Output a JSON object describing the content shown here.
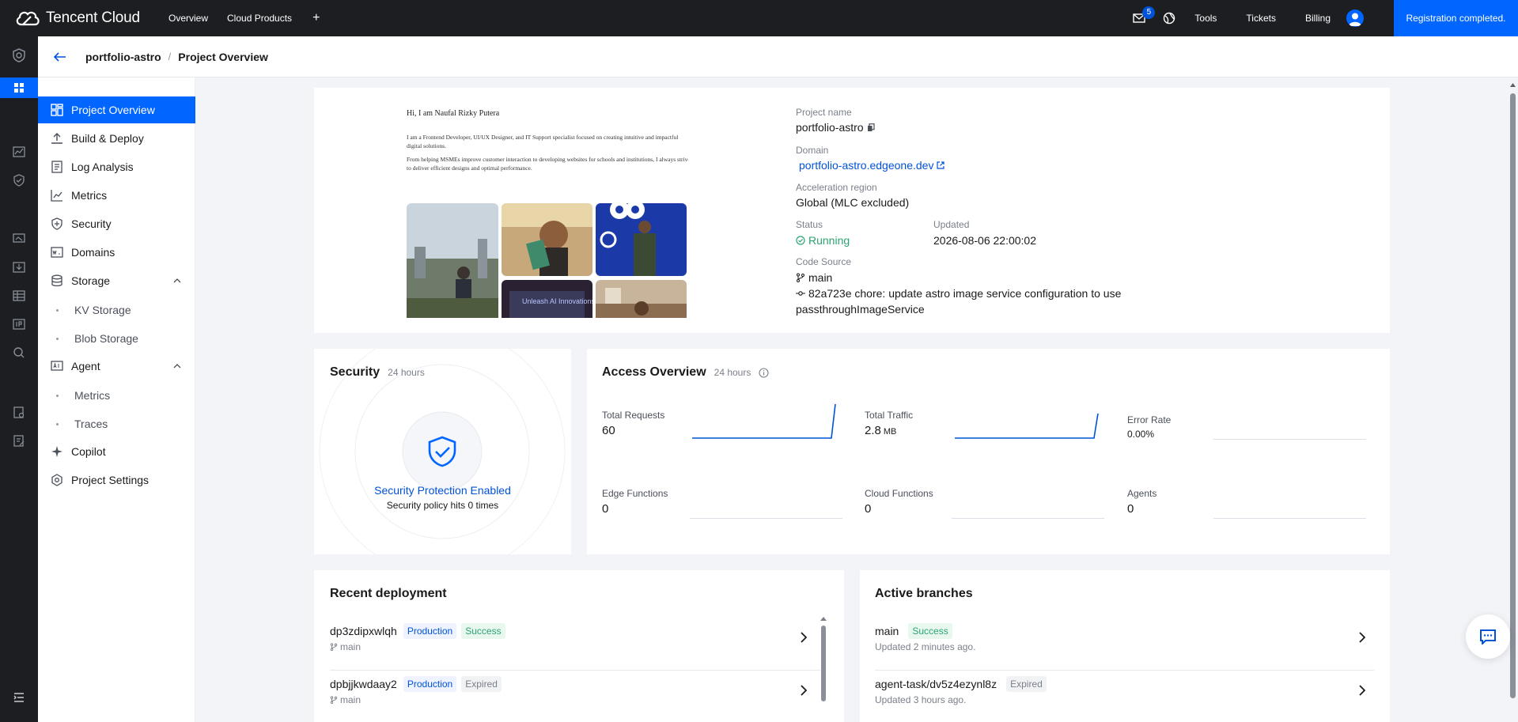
{
  "topbar": {
    "brand": "Tencent Cloud",
    "nav": [
      "Overview",
      "Cloud Products"
    ],
    "mail_count": "5",
    "links": [
      "Tools",
      "Tickets",
      "Billing"
    ],
    "registration": "Registration completed."
  },
  "breadcrumb": {
    "project": "portfolio-astro",
    "separator": "/",
    "page": "Project Overview"
  },
  "sidenav": {
    "items": [
      {
        "label": "Project Overview",
        "icon": "dashboard-icon"
      },
      {
        "label": "Build & Deploy",
        "icon": "upload-icon"
      },
      {
        "label": "Log Analysis",
        "icon": "document-icon"
      },
      {
        "label": "Metrics",
        "icon": "line-chart-icon"
      },
      {
        "label": "Security",
        "icon": "shield-icon"
      },
      {
        "label": "Domains",
        "icon": "domain-icon"
      },
      {
        "label": "Storage",
        "icon": "database-icon"
      },
      {
        "label": "KV Storage"
      },
      {
        "label": "Blob Storage"
      },
      {
        "label": "Agent",
        "icon": "ai-icon"
      },
      {
        "label": "Metrics"
      },
      {
        "label": "Traces"
      },
      {
        "label": "Copilot",
        "icon": "sparkle-icon"
      },
      {
        "label": "Project Settings",
        "icon": "settings-icon"
      }
    ]
  },
  "preview": {
    "heading": "Hi, I am Naufal Rizky Putera",
    "p1": "I am a Frontend Developer, UI/UX Designer, and IT Support specialist focused on creating intuitive and impactful digital solutions.",
    "p2": "From helping MSMEs improve customer interaction to developing websites for schools and institutions, I always strive to deliver efficient designs and optimal performance.",
    "photo_text": "Unleash AI Innovations"
  },
  "project": {
    "name_label": "Project name",
    "name": "portfolio-astro",
    "domain_label": "Domain",
    "domain": "portfolio-astro.edgeone.dev",
    "region_label": "Acceleration region",
    "region": "Global (MLC excluded)",
    "status_label": "Status",
    "status": "Running",
    "updated_label": "Updated",
    "updated": "2026-08-06 22:00:02",
    "source_label": "Code Source",
    "branch": "main",
    "commit": "82a723e chore: update astro image service configuration to use",
    "commit_cont": "passthroughImageService"
  },
  "security": {
    "title": "Security",
    "period": "24 hours",
    "status": "Security Protection Enabled",
    "hits": "Security policy hits 0 times"
  },
  "access": {
    "title": "Access Overview",
    "period": "24 hours",
    "metrics": [
      {
        "label": "Total Requests",
        "value": "60",
        "unit": ""
      },
      {
        "label": "Total Traffic",
        "value": "2.8",
        "unit": "MB"
      },
      {
        "label": "Error Rate",
        "value": "0.00%",
        "unit": ""
      },
      {
        "label": "Edge Functions",
        "value": "0",
        "unit": ""
      },
      {
        "label": "Cloud Functions",
        "value": "0",
        "unit": ""
      },
      {
        "label": "Agents",
        "value": "0",
        "unit": ""
      }
    ]
  },
  "deployments": {
    "title": "Recent deployment",
    "rows": [
      {
        "id": "dp3zdipxwlqh",
        "env": "Production",
        "status": "Success",
        "branch": "main"
      },
      {
        "id": "dpbjjkwdaay2",
        "env": "Production",
        "status": "Expired",
        "branch": "main"
      }
    ]
  },
  "branches": {
    "title": "Active branches",
    "rows": [
      {
        "name": "main",
        "status": "Success",
        "updated": "Updated 2 minutes ago."
      },
      {
        "name": "agent-task/dv5z4ezynl8z",
        "status": "Expired",
        "updated": "Updated 3 hours ago."
      }
    ]
  },
  "colors": {
    "accent": "#0066ff",
    "success": "#2ba471",
    "topbar": "#1c1e22"
  }
}
